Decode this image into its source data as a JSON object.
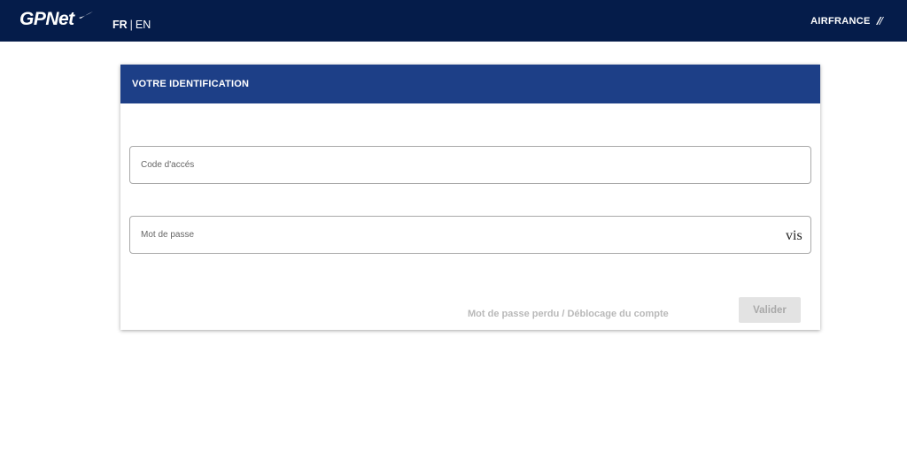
{
  "header": {
    "logo_text": "GPNet",
    "lang_fr": "FR",
    "lang_sep": "|",
    "lang_en": "EN",
    "brand": "AIRFRANCE",
    "background": "#051c4a"
  },
  "login": {
    "title": "VOTRE IDENTIFICATION",
    "header_color": "#1d3f87",
    "code_field": {
      "placeholder": "Code d'accés",
      "value": ""
    },
    "password_field": {
      "placeholder": "Mot de passe",
      "value": "",
      "toggle_label": "visibility"
    },
    "lost_password_link": "Mot de passe perdu / Déblocage du compte",
    "submit_label": "Valider"
  }
}
